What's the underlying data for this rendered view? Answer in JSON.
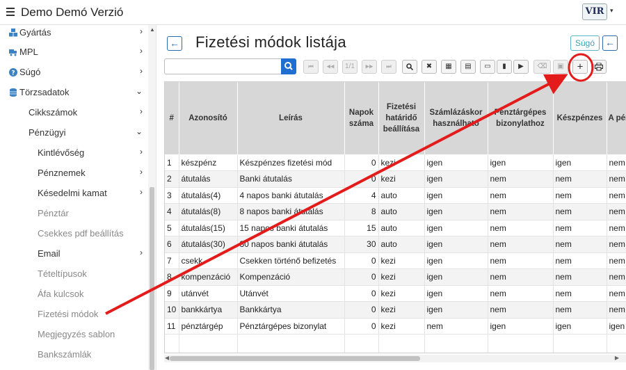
{
  "app": {
    "title": "Demo Demó Verzió",
    "logo_text": "VIR",
    "logo_caret": "▾"
  },
  "sidebar": {
    "items": [
      {
        "label": "Gyártás",
        "icon": "cubes-icon",
        "chevron": "›"
      },
      {
        "label": "MPL",
        "icon": "truck-icon",
        "chevron": "›"
      },
      {
        "label": "Súgó",
        "icon": "question-icon",
        "chevron": "›"
      },
      {
        "label": "Törzsadatok",
        "icon": "database-icon",
        "chevron": "⌄"
      },
      {
        "label": "Cikkszámok",
        "chevron": "›"
      },
      {
        "label": "Pénzügyi",
        "chevron": "⌄"
      },
      {
        "label": "Kintlévőség",
        "chevron": "›"
      },
      {
        "label": "Pénznemek",
        "chevron": "›"
      },
      {
        "label": "Késedelmi kamat",
        "chevron": "›"
      },
      {
        "label": "Pénztár",
        "chevron": ""
      },
      {
        "label": "Csekkes pdf beállítás",
        "chevron": ""
      },
      {
        "label": "Email",
        "chevron": "›"
      },
      {
        "label": "Tételtípusok",
        "chevron": ""
      },
      {
        "label": "Áfa kulcsok",
        "chevron": ""
      },
      {
        "label": "Fizetési módok",
        "chevron": ""
      },
      {
        "label": "Megjegyzés sablon",
        "chevron": ""
      },
      {
        "label": "Bankszámlák",
        "chevron": ""
      }
    ]
  },
  "main": {
    "title": "Fizetési módok listája",
    "back_label": "←",
    "help_label": "Súgó",
    "back2_label": "←",
    "search": {
      "value": "",
      "placeholder": ""
    }
  },
  "toolbar": {
    "pager_text": "1/1",
    "buttons": [
      {
        "name": "first-page-button",
        "icon": "first-page-icon",
        "glyph": "⏮"
      },
      {
        "name": "prev-page-button",
        "icon": "prev-page-icon",
        "glyph": "◀◀"
      },
      {
        "name": "page-indicator",
        "icon": "",
        "glyph": "1/1"
      },
      {
        "name": "next-page-button",
        "icon": "next-page-icon",
        "glyph": "▶▶"
      },
      {
        "name": "last-page-button",
        "icon": "last-page-icon",
        "glyph": "⏭"
      },
      {
        "name": "zoom-button",
        "icon": "magnifier-icon",
        "glyph": "🔍"
      },
      {
        "name": "tools-button",
        "icon": "tools-icon",
        "glyph": "✖"
      },
      {
        "name": "calculator-button",
        "icon": "calculator-icon",
        "glyph": "▦"
      },
      {
        "name": "columns-button",
        "icon": "columns-icon",
        "glyph": "▤"
      },
      {
        "name": "export-button",
        "icon": "file-icon",
        "glyph": "▭"
      },
      {
        "name": "export-pdf-button",
        "icon": "file-pdf-icon",
        "glyph": "▮"
      },
      {
        "name": "import-button",
        "icon": "file-import-icon",
        "glyph": "▶"
      },
      {
        "name": "delete-button",
        "icon": "backspace-icon",
        "glyph": "⌫"
      },
      {
        "name": "clear-button",
        "icon": "close-box-icon",
        "glyph": "▣"
      },
      {
        "name": "add-button",
        "icon": "plus-icon",
        "glyph": "+"
      },
      {
        "name": "print-button",
        "icon": "printer-icon",
        "glyph": "⎙"
      }
    ]
  },
  "table": {
    "headers": [
      "#",
      "Azonosító",
      "Leírás",
      "Napok száma",
      "Fizetési határidő beállítása",
      "Számlázáskor használható",
      "Pénztárgépes bizonylathoz",
      "Készpénzes",
      "A pén"
    ],
    "rows": [
      [
        "1",
        "készpénz",
        "Készpénzes fizetési mód",
        "0",
        "kezi",
        "igen",
        "igen",
        "igen",
        "nem"
      ],
      [
        "2",
        "átutalás",
        "Banki átutalás",
        "0",
        "kezi",
        "igen",
        "nem",
        "nem",
        "nem"
      ],
      [
        "3",
        "átutalás(4)",
        "4 napos banki átutalás",
        "4",
        "auto",
        "igen",
        "nem",
        "nem",
        "nem"
      ],
      [
        "4",
        "átutalás(8)",
        "8 napos banki átutalás",
        "8",
        "auto",
        "igen",
        "nem",
        "nem",
        "nem"
      ],
      [
        "5",
        "átutalás(15)",
        "15 napos banki átutalás",
        "15",
        "auto",
        "igen",
        "nem",
        "nem",
        "nem"
      ],
      [
        "6",
        "átutalás(30)",
        "30 napos banki átutalás",
        "30",
        "auto",
        "igen",
        "nem",
        "nem",
        "nem"
      ],
      [
        "7",
        "csekk",
        "Csekken történő befizetés",
        "0",
        "kezi",
        "igen",
        "nem",
        "nem",
        "nem"
      ],
      [
        "8",
        "kompenzáció",
        "Kompenzáció",
        "0",
        "kezi",
        "igen",
        "nem",
        "nem",
        "nem"
      ],
      [
        "9",
        "utánvét",
        "Utánvét",
        "0",
        "kezi",
        "igen",
        "nem",
        "nem",
        "nem"
      ],
      [
        "10",
        "bankkártya",
        "Bankkártya",
        "0",
        "kezi",
        "igen",
        "nem",
        "nem",
        "nem"
      ],
      [
        "11",
        "pénztárgép",
        "Pénztárgépes bizonylat",
        "0",
        "kezi",
        "nem",
        "igen",
        "igen",
        "igen"
      ]
    ]
  },
  "colors": {
    "accent": "#1f6fd1",
    "help": "#3aa1b7",
    "annotation": "#e31b1b",
    "header_bg": "#d7d7d7"
  }
}
